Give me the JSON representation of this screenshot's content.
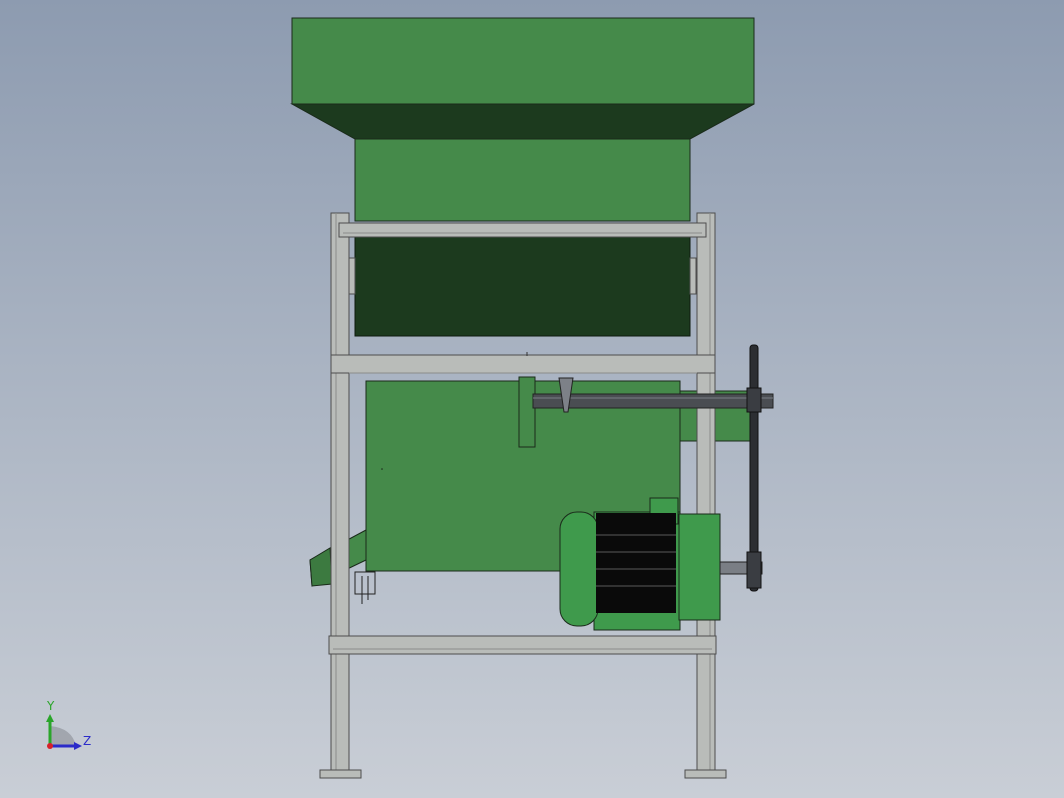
{
  "viewport": {
    "background_top": "#8d9bb0",
    "background_bottom": "#c9ced6"
  },
  "model": {
    "name": "machine-assembly-side-view",
    "colors": {
      "body_green": "#458a4a",
      "dark_green": "#1c3a1e",
      "frame_gray": "#b9bcb9",
      "frame_edge": "#4d4d4d",
      "motor_black": "#0a0a0a",
      "motor_green": "#3f9a4c",
      "shaft_gray": "#4a4d52"
    },
    "parts": [
      "hopper",
      "frame",
      "drum-housing",
      "shaft",
      "pulley",
      "belt",
      "motor",
      "discharge-chute",
      "feet"
    ]
  },
  "triad": {
    "y_label": "Y",
    "z_label": "Z",
    "y_color": "#2aa52a",
    "z_color": "#2b2bc9",
    "origin_color": "#d8202a"
  }
}
